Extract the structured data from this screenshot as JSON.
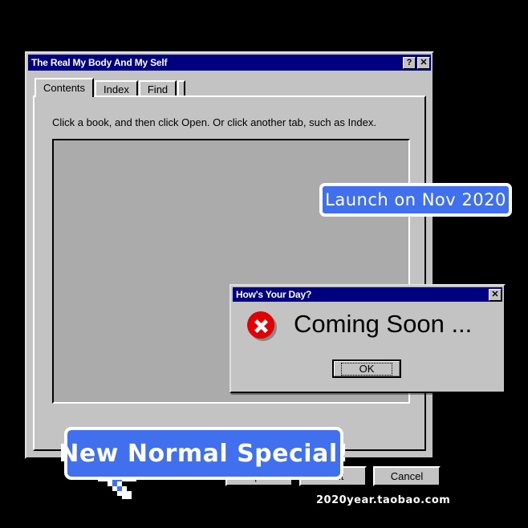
{
  "window": {
    "title": "The Real My Body And My Self",
    "help_button": "?",
    "close_button": "✕",
    "tabs": [
      {
        "label": "Contents",
        "active": true
      },
      {
        "label": "Index",
        "active": false
      },
      {
        "label": "Find",
        "active": false
      }
    ],
    "hint": "Click a book, and then click Open. Or click another tab, such as Index.",
    "buttons": {
      "open": "Open",
      "print": "Print",
      "cancel": "Cancel"
    }
  },
  "error_dialog": {
    "title": "How's Your Day?",
    "close_button": "✕",
    "icon": "error-x-icon",
    "message": "Coming Soon ...",
    "ok_label": "OK"
  },
  "badges": {
    "launch": "Launch on Nov 2020",
    "special": "New Normal Special!"
  },
  "watermark": "2020year.taobao.com",
  "colors": {
    "title_bar": "#000080",
    "dialog_face": "#c3c3c3",
    "list_panel": "#ababab",
    "badge_blue": "#4070ee",
    "error_red": "#e00000",
    "backdrop": "#000000"
  }
}
